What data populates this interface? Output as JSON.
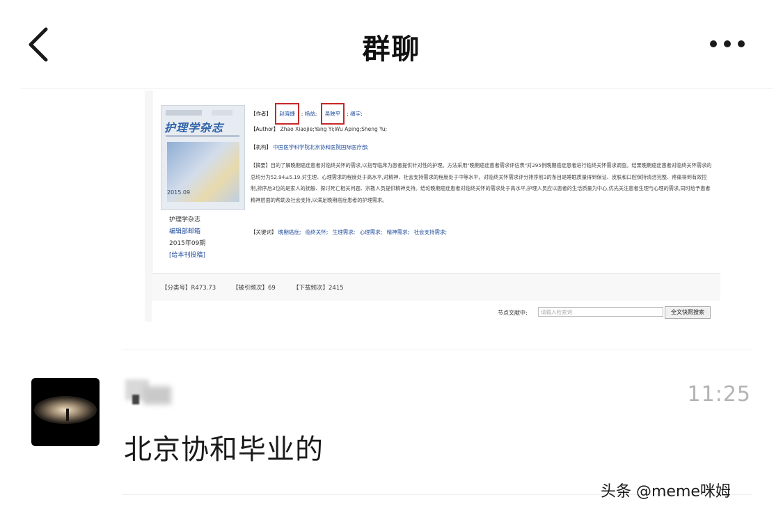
{
  "header": {
    "title": "群聊"
  },
  "image": {
    "cover_title": "护理学杂志",
    "cover_year": "2015.09",
    "journal_lines": [
      "护理学杂志",
      "编辑部邮箱",
      "2015年09期",
      "[给本刊投稿]"
    ],
    "author_label": "【作者】",
    "authors": [
      "赵晓捷",
      "杨益",
      "吴映平",
      "绳宇"
    ],
    "author_en_label": "【Author】",
    "author_en": "Zhao Xiaojie;Yang Yi;Wu Aping;Sheng Yu;",
    "org_label": "【机构】",
    "org": "中国医学科学院北京协和医院国际医疗部;",
    "abstract_label": "【摘要】",
    "abstract": "目的了解晚期癌症患者对临终关怀的需求,以指导临床为患者提供针对性的护理。方法采用\"晚期癌症患者需求评估表\"对295例晚期癌症患者进行临终关怀需求调查。结果晚期癌症患者对临终关怀需求的总均分为52.94±5.19,对生理、心理需求的程度处于高水平,对精神、社会支持需求的程度处于中等水平。对临终关怀需求评分排序前3的条目是睡眠质量得到保证、皮肤和口腔保持清洁完整、疼痛得到有效控制,排序后3位的是家人的抚触、探讨死亡相关问题、宗教人员提供精神支持。结论晚期癌症患者对临终关怀的需求处于高水平,护理人员应以患者的生活质量为中心,优先关注患者生理与心理的需求,同时给予患者精神层面的帮助及社会支持,以满足晚期癌症患者的护理需求。",
    "keywords_label": "【关键词】",
    "keywords": [
      "晚期癌症;",
      "临终关怀;",
      "生理需求;",
      "心理需求;",
      "精神需求;",
      "社会支持需求;"
    ],
    "classification": "【分类号】R473.73",
    "cited": "【被引频次】69",
    "downloads": "【下载频次】2415",
    "search_label": "节点文献中:",
    "search_placeholder": "请输入检索词",
    "search_button": "全文快照搜索"
  },
  "message": {
    "time": "11:25",
    "text": "北京协和毕业的"
  },
  "watermark": "头条 @meme咪姆"
}
